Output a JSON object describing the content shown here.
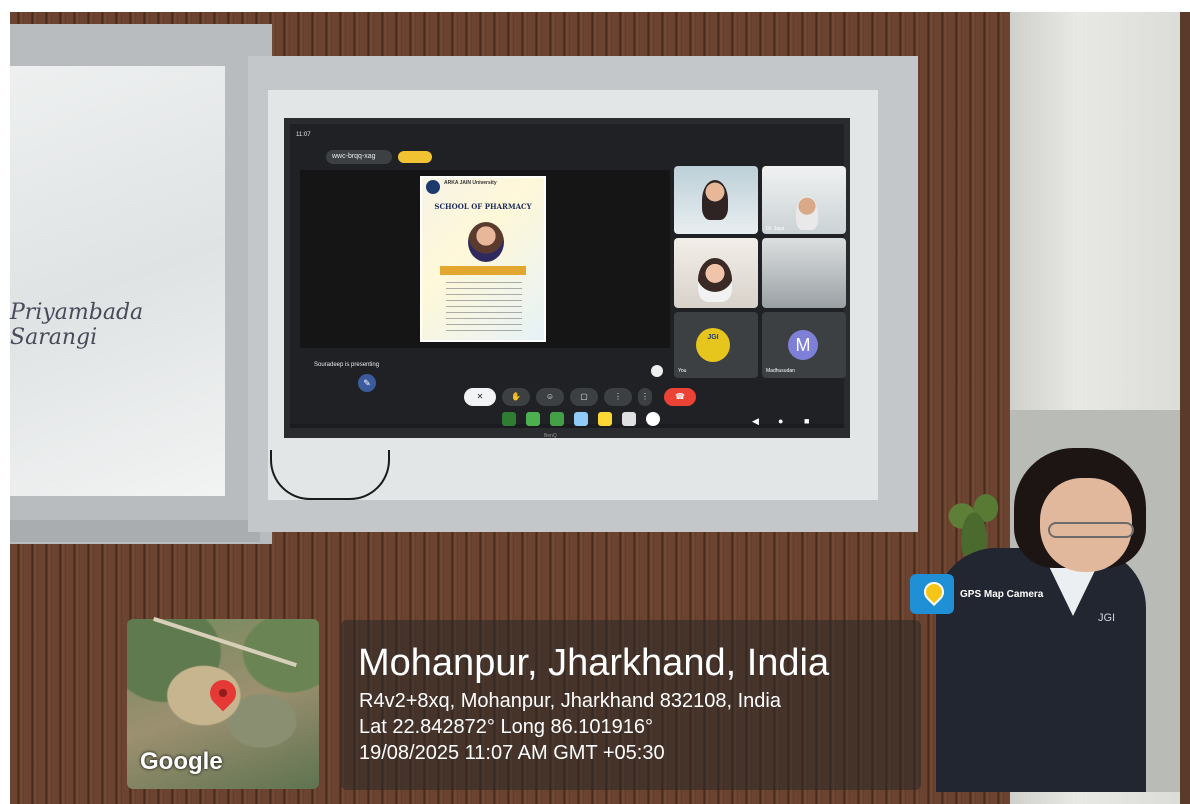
{
  "tv": {
    "status_time": "11:07",
    "meet_code": "wwc-brqq-xag",
    "presenting_text": "Souradeep is presenting",
    "brand": "BenQ"
  },
  "poster": {
    "institution": "ARKA JAIN University",
    "school": "SCHOOL OF PHARMACY"
  },
  "participants": [
    {
      "name": "",
      "avatar": ""
    },
    {
      "name": "Dr. Jaya",
      "avatar": ""
    },
    {
      "name": "",
      "avatar": ""
    },
    {
      "name": "",
      "avatar": ""
    },
    {
      "name": "You",
      "avatar": "JGI"
    },
    {
      "name": "Madhusudan",
      "avatar": "M"
    }
  ],
  "board": {
    "signature": "Priyambada Sarangi"
  },
  "gps": {
    "app_name": "GPS Map Camera",
    "title": "Mohanpur, Jharkhand, India",
    "address": "R4v2+8xq, Mohanpur, Jharkhand 832108, India",
    "coords": "Lat 22.842872° Long 86.101916°",
    "datetime": "19/08/2025 11:07 AM GMT +05:30",
    "map_label": "Google"
  },
  "student": {
    "badge": "JGI"
  },
  "colors": {
    "meet_red": "#ea4335",
    "avatar_m": "#7e80d8",
    "jgi_yellow": "#e6c51d",
    "pin_red": "#e53935"
  }
}
